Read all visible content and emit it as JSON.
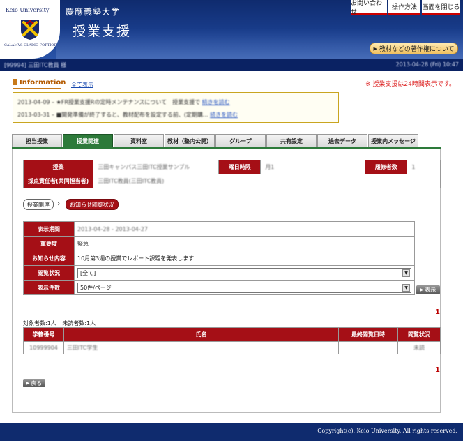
{
  "header": {
    "logo_title": "Keio University",
    "logo_year": "1858",
    "logo_motto": "CALAMVS GLADIO FORTIOR",
    "university_name": "慶應義塾大学",
    "system_name": "授業支援",
    "buttons": {
      "contact": "お問い合わせ",
      "manual": "操作方法",
      "close": "画面を閉じる",
      "copyright": "教材などの著作権について"
    }
  },
  "userbar": {
    "user": "[99994] 三田ITC教員 様",
    "datetime": "2013-04-28 (Fri) 10:47"
  },
  "information": {
    "heading": "Information",
    "show_all": "全て表示",
    "count_notice": "※ 授業支援は24時間表示です。",
    "items": [
      {
        "text": "2013-04-09 – ★FR授業支援Rの定時メンテナンスについて　授業支援で",
        "more": "続きを読む"
      },
      {
        "text": "2013-03-31 – ■開発準備が終了すると、教材配布を設定する前、(定期購...",
        "more": "続きを読む"
      }
    ]
  },
  "tabs": [
    {
      "label": "担当授業"
    },
    {
      "label": "授業関連",
      "active": true
    },
    {
      "label": "資料室"
    },
    {
      "label": "教材（塾内公開）"
    },
    {
      "label": "グループ"
    },
    {
      "label": "共有設定"
    },
    {
      "label": "過去データ"
    },
    {
      "label": "授業内メッセージ"
    }
  ],
  "course": {
    "course_label": "授業",
    "course_value": "三田キャンパス三田ITC授業サンプル",
    "day_label": "曜日時限",
    "day_value": "月1",
    "enroll_label": "履修者数",
    "enroll_value": "1",
    "grader_label": "採点責任者(共同担当者)",
    "grader_value": "三田ITC教員(三田ITC教員)"
  },
  "breadcrumb": {
    "parent": "授業関連",
    "current": "お知らせ閲覧状況"
  },
  "filter": {
    "period_label": "表示期間",
    "period_value": "2013-04-28 - 2013-04-27",
    "importance_label": "重要度",
    "importance_value": "緊急",
    "content_label": "お知らせ内容",
    "content_value": "10月第3週の授業でレポート課題を発表します",
    "status_label": "閲覧状況",
    "status_selected": "[全て]",
    "count_label": "表示件数",
    "count_selected": "50件/ページ",
    "display_button": "表示"
  },
  "pagination": {
    "page": "1"
  },
  "counts": {
    "target": "対象者数:1人",
    "unread": "未読者数:1人"
  },
  "students": {
    "headers": [
      "学籍番号",
      "氏名",
      "最終閲覧日時",
      "閲覧状況"
    ],
    "rows": [
      {
        "id": "10999904",
        "name": "三田ITC学生",
        "last_viewed": "",
        "status": "未読"
      }
    ]
  },
  "back_button": "戻る",
  "footer": {
    "copyright": "Copyright(c), Keio University.  All rights reserved."
  },
  "colors": {
    "header_bg": "#0f2b6e",
    "tab_active": "#2d7a3a",
    "table_header_red": "#a50f16",
    "info_orange": "#b35a00"
  }
}
